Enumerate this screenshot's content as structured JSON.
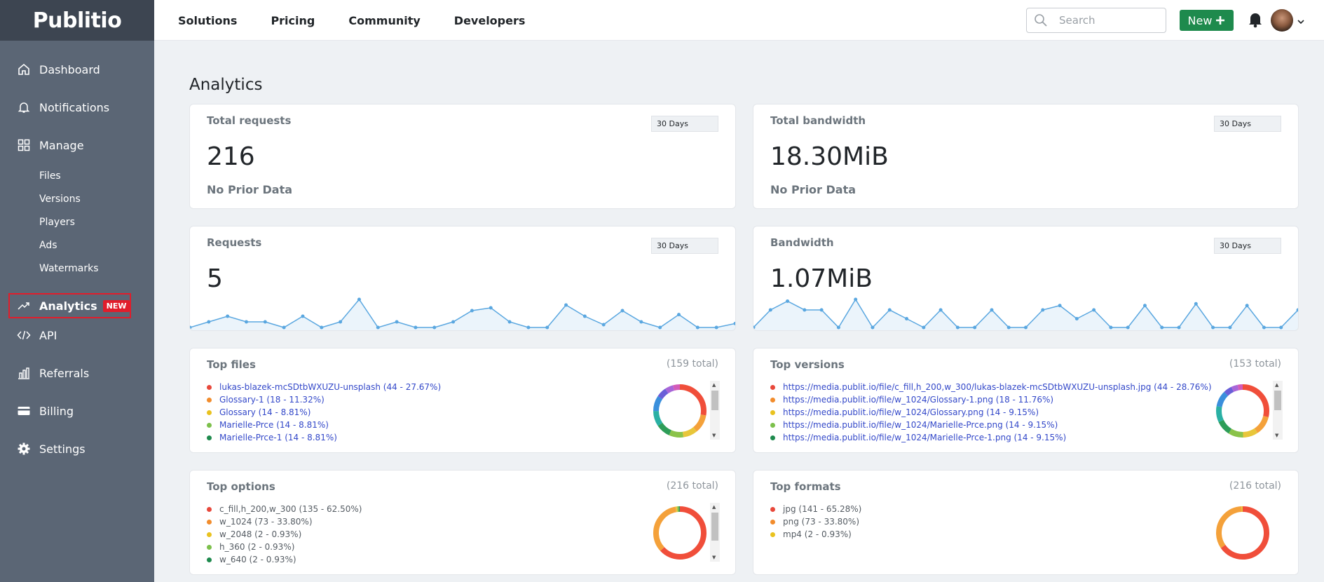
{
  "app": {
    "logo": "Publitio"
  },
  "sidebar": {
    "items": [
      {
        "label": "Dashboard",
        "icon": "home-icon"
      },
      {
        "label": "Notifications",
        "icon": "bell-outline-icon"
      },
      {
        "label": "Manage",
        "icon": "grid-icon"
      }
    ],
    "manage_sub": [
      "Files",
      "Versions",
      "Players",
      "Ads",
      "Watermarks"
    ],
    "analytics": {
      "label": "Analytics",
      "badge": "NEW",
      "icon": "trend-icon"
    },
    "lower_items": [
      {
        "label": "API",
        "icon": "code-icon"
      },
      {
        "label": "Referrals",
        "icon": "bar-chart-icon"
      },
      {
        "label": "Billing",
        "icon": "card-icon"
      },
      {
        "label": "Settings",
        "icon": "gear-icon"
      }
    ]
  },
  "topbar": {
    "nav": [
      "Solutions",
      "Pricing",
      "Community",
      "Developers"
    ],
    "search_placeholder": "Search",
    "new_label": "New",
    "new_icon": "plus-icon",
    "bell_icon": "bell-icon"
  },
  "page": {
    "title": "Analytics"
  },
  "stats": {
    "total_requests": {
      "title": "Total requests",
      "range": "30 Days",
      "value": "216",
      "note": "No Prior Data"
    },
    "total_bandwidth": {
      "title": "Total bandwidth",
      "range": "30 Days",
      "value": "18.30MiB",
      "note": "No Prior Data"
    },
    "requests": {
      "title": "Requests",
      "range": "30 Days",
      "value": "5"
    },
    "bandwidth": {
      "title": "Bandwidth",
      "range": "30 Days",
      "value": "1.07MiB"
    }
  },
  "top_files": {
    "title": "Top files",
    "total": "(159 total)",
    "items": [
      "lukas-blazek-mcSDtbWXUZU-unsplash (44 - 27.67%)",
      "Glossary-1 (18 - 11.32%)",
      "Glossary (14 - 8.81%)",
      "Marielle-Prce (14 - 8.81%)",
      "Marielle-Prce-1 (14 - 8.81%)"
    ]
  },
  "top_versions": {
    "title": "Top versions",
    "total": "(153 total)",
    "items": [
      "https://media.publit.io/file/c_fill,h_200,w_300/lukas-blazek-mcSDtbWXUZU-unsplash.jpg (44 - 28.76%)",
      "https://media.publit.io/file/w_1024/Glossary-1.png (18 - 11.76%)",
      "https://media.publit.io/file/w_1024/Glossary.png (14 - 9.15%)",
      "https://media.publit.io/file/w_1024/Marielle-Prce.png (14 - 9.15%)",
      "https://media.publit.io/file/w_1024/Marielle-Prce-1.png (14 - 9.15%)"
    ]
  },
  "top_options": {
    "title": "Top options",
    "total": "(216 total)",
    "items": [
      "c_fill,h_200,w_300 (135 - 62.50%)",
      "w_1024 (73 - 33.80%)",
      "w_2048 (2 - 0.93%)",
      "h_360 (2 - 0.93%)",
      "w_640 (2 - 0.93%)"
    ]
  },
  "top_formats": {
    "title": "Top formats",
    "total": "(216 total)",
    "items": [
      "jpg (141 - 65.28%)",
      "png (73 - 33.80%)",
      "mp4 (2 - 0.93%)"
    ]
  },
  "colors": {
    "list_dots": [
      "#e8483b",
      "#f28c2c",
      "#e9c21f",
      "#7cc04b",
      "#1e8a4d"
    ],
    "files_donut": [
      "#f04e3a",
      "#f4a13a",
      "#e8c63a",
      "#8bc34a",
      "#2e9d58",
      "#2ab0a4",
      "#3a8fdc",
      "#6a5fd8",
      "#a866d8",
      "#d35bb8"
    ],
    "options_donut": [
      "#f04e3a",
      "#f4a13a",
      "#e8c63a",
      "#8bc34a",
      "#2e9d58"
    ],
    "spark_line": "#5aa7e0",
    "accent": "#1e8a4d",
    "highlight": "#e11d2b"
  },
  "charts": {
    "requests_series": [
      0,
      1,
      2,
      1,
      1,
      0,
      2,
      0,
      1,
      5,
      0,
      1,
      0,
      0,
      1,
      3,
      3.5,
      1,
      0,
      0,
      4,
      2,
      0.5,
      3,
      1,
      0,
      2.3,
      0,
      0,
      0.7
    ],
    "bandwidth_series": [
      0,
      2,
      3,
      2,
      2,
      0,
      3.2,
      0,
      2,
      1,
      0,
      2,
      0,
      0,
      2,
      0,
      0,
      2,
      2.5,
      1,
      2,
      0,
      0,
      2.5,
      0,
      0,
      2.7,
      0,
      0,
      2.5,
      0,
      0,
      2
    ],
    "files_donut": [
      44,
      18,
      14,
      14,
      14,
      15,
      15,
      10,
      8,
      7
    ],
    "versions_donut": [
      44,
      18,
      14,
      14,
      14,
      15,
      15,
      8,
      6,
      5
    ],
    "options_donut": [
      135,
      73,
      2,
      2,
      2
    ],
    "formats_donut": [
      141,
      73,
      2
    ]
  }
}
